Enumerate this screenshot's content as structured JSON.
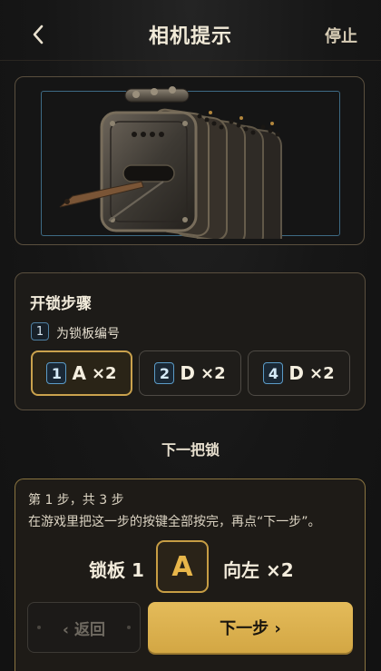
{
  "header": {
    "title": "相机提示",
    "stop_label": "停止"
  },
  "steps_card": {
    "title": "开锁步骤",
    "hint_number": "1",
    "hint_text": "为锁板编号",
    "chips": [
      {
        "num": "1",
        "key": "A",
        "count": "×2",
        "active": true
      },
      {
        "num": "2",
        "key": "D",
        "count": "×2",
        "active": false
      },
      {
        "num": "4",
        "key": "D",
        "count": "×2",
        "active": false
      }
    ]
  },
  "next_lock_label": "下一把锁",
  "panel": {
    "progress": "第 1 步，共 3 步",
    "instruction": "在游戏里把这一步的按键全部按完，再点“下一步”。",
    "plate": "锁板 1",
    "key": "A",
    "direction": "向左 ×2",
    "back_label": "‹ 返回",
    "next_label": "下一步 ›"
  },
  "colors": {
    "accent": "#d3a744",
    "key_blue": "#5b9bc7",
    "bg": "#161616"
  }
}
